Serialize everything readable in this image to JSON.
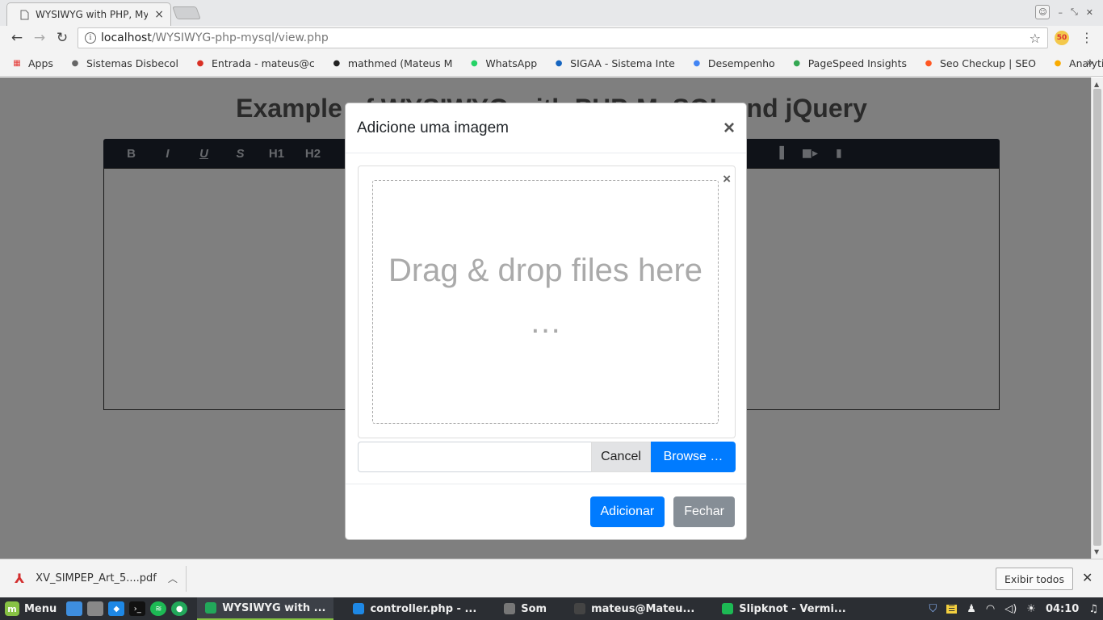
{
  "browser": {
    "tab_title": "WYSIWYG with PHP, My",
    "tab_close": "×",
    "url_host": "localhost",
    "url_path": "/WYSIWYG-php-mysql/view.php",
    "ext_label": "50"
  },
  "bookmarks": [
    {
      "label": "Apps",
      "icon": "apps-grid-icon",
      "color": "#e53935"
    },
    {
      "label": "Sistemas Disbecol",
      "icon": "page-icon",
      "color": "#666666"
    },
    {
      "label": "Entrada - mateus@c",
      "icon": "gmail-icon",
      "color": "#d93025"
    },
    {
      "label": "mathmed (Mateus M",
      "icon": "github-icon",
      "color": "#222222"
    },
    {
      "label": "WhatsApp",
      "icon": "whatsapp-icon",
      "color": "#25d366"
    },
    {
      "label": "SIGAA - Sistema Inte",
      "icon": "sigaa-icon",
      "color": "#1565c0"
    },
    {
      "label": "Desempenho",
      "icon": "drive-icon",
      "color": "#4285f4"
    },
    {
      "label": "PageSpeed Insights",
      "icon": "pagespeed-icon",
      "color": "#34a853"
    },
    {
      "label": "Seo Checkup | SEO",
      "icon": "seo-icon",
      "color": "#ff5722"
    },
    {
      "label": "Analytics",
      "icon": "analytics-icon",
      "color": "#f9ab00"
    }
  ],
  "page": {
    "title": "Example of WYSIWYG with PHP-MySQL and jQuery",
    "toolbar": [
      "B",
      "I",
      "U",
      "S",
      "H1",
      "H2"
    ]
  },
  "modal": {
    "title": "Adicione uma imagem",
    "close": "×",
    "drop_text": "Drag & drop files here …",
    "remove": "×",
    "cancel_label": "Cancel",
    "browse_label": "Browse …",
    "submit_label": "Adicionar",
    "close_label": "Fechar"
  },
  "download": {
    "file_name": "XV_SIMPEP_Art_5....pdf",
    "show_all": "Exibir todos",
    "close": "✕"
  },
  "taskbar": {
    "menu_label": "Menu",
    "tasks": [
      {
        "label": "WYSIWYG with ...",
        "icon": "chrome-icon",
        "color": "#22a85a",
        "active": true
      },
      {
        "label": "controller.php - ...",
        "icon": "vscode-icon",
        "color": "#1e88e5",
        "active": false
      },
      {
        "label": "Som",
        "icon": "sound-settings-icon",
        "color": "#777777",
        "active": false
      },
      {
        "label": "mateus@Mateu...",
        "icon": "terminal-icon",
        "color": "#444444",
        "active": false
      },
      {
        "label": "Slipknot - Vermi...",
        "icon": "spotify-icon",
        "color": "#1db954",
        "active": false
      }
    ],
    "clock": "04:10"
  }
}
